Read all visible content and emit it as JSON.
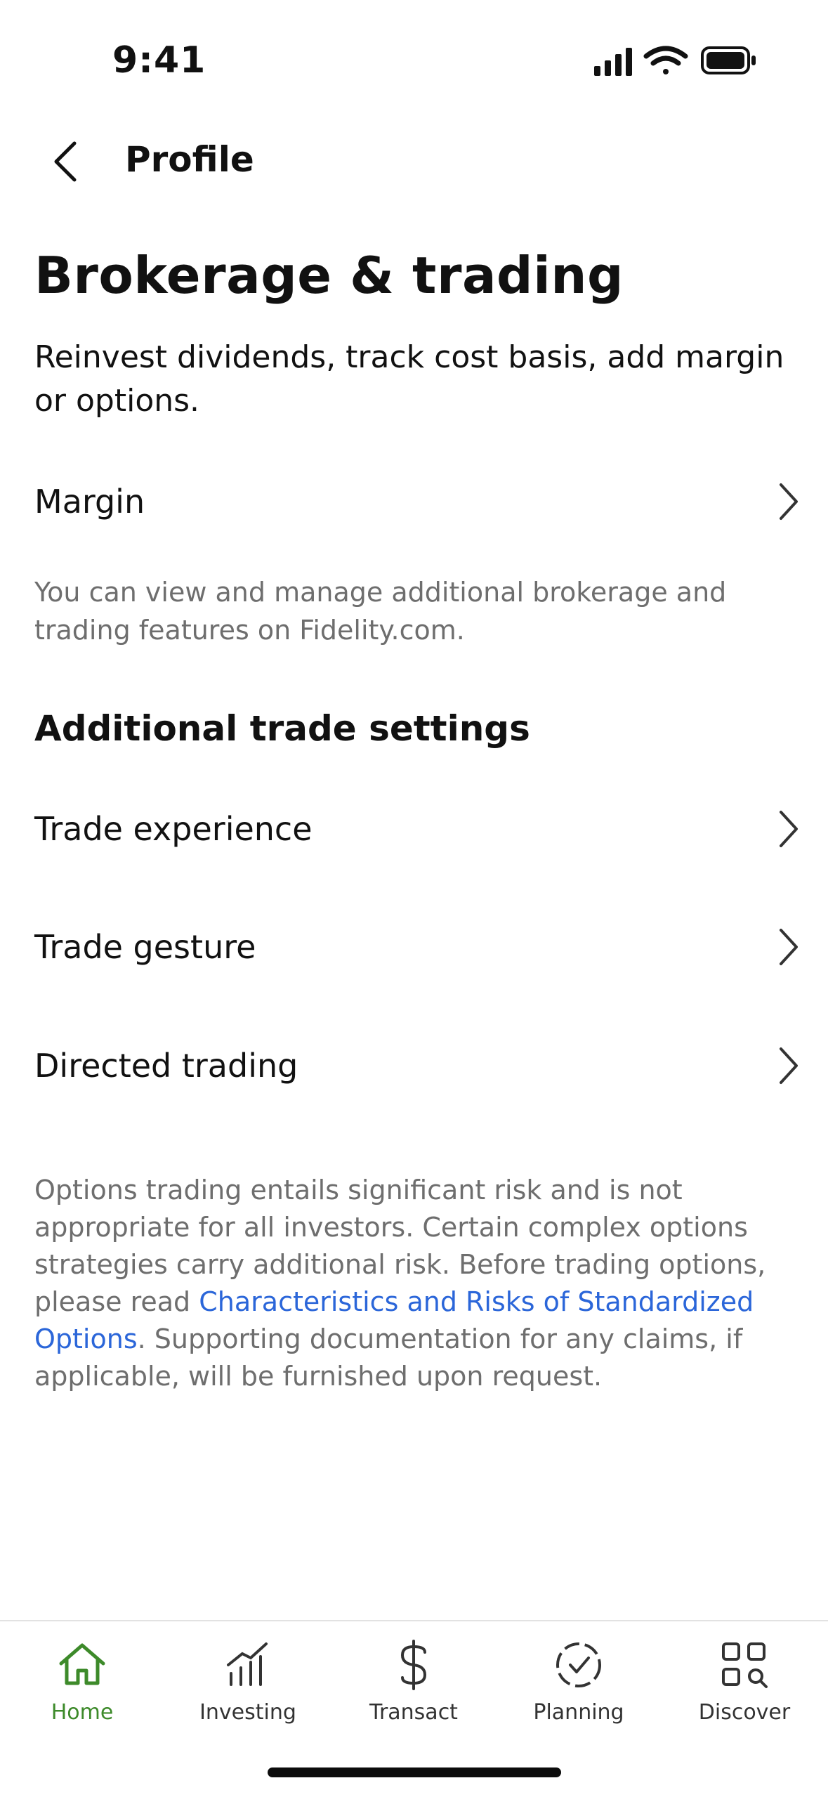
{
  "status_bar": {
    "time": "9:41"
  },
  "header": {
    "back_label": "Profile"
  },
  "page": {
    "title": "Brokerage & trading",
    "subtitle": "Reinvest dividends, track cost basis, add margin or options."
  },
  "margin_row": {
    "label": "Margin"
  },
  "info_text": "You can view and manage additional brokerage and trading features on Fidelity.com.",
  "additional": {
    "heading": "Additional trade settings",
    "items": [
      {
        "label": "Trade experience"
      },
      {
        "label": "Trade gesture"
      },
      {
        "label": "Directed trading"
      }
    ]
  },
  "disclaimer": {
    "before_link": "Options trading entails significant risk and is not appropriate for all investors. Certain complex options strategies carry additional risk. Before trading options, please read ",
    "link_text": "Characteristics and Risks of Standardized Options",
    "after_link": ". Supporting documentation for any claims, if applicable, will be furnished upon request."
  },
  "tab_bar": {
    "active": "Home",
    "tabs": [
      {
        "label": "Home",
        "icon": "home-icon"
      },
      {
        "label": "Investing",
        "icon": "bar-chart-icon"
      },
      {
        "label": "Transact",
        "icon": "dollar-icon"
      },
      {
        "label": "Planning",
        "icon": "planning-check-icon"
      },
      {
        "label": "Discover",
        "icon": "discover-grid-icon"
      }
    ]
  },
  "colors": {
    "accent_green": "#3d8a2a",
    "link_blue": "#2b66d9",
    "secondary_text": "#6e6e6e"
  }
}
